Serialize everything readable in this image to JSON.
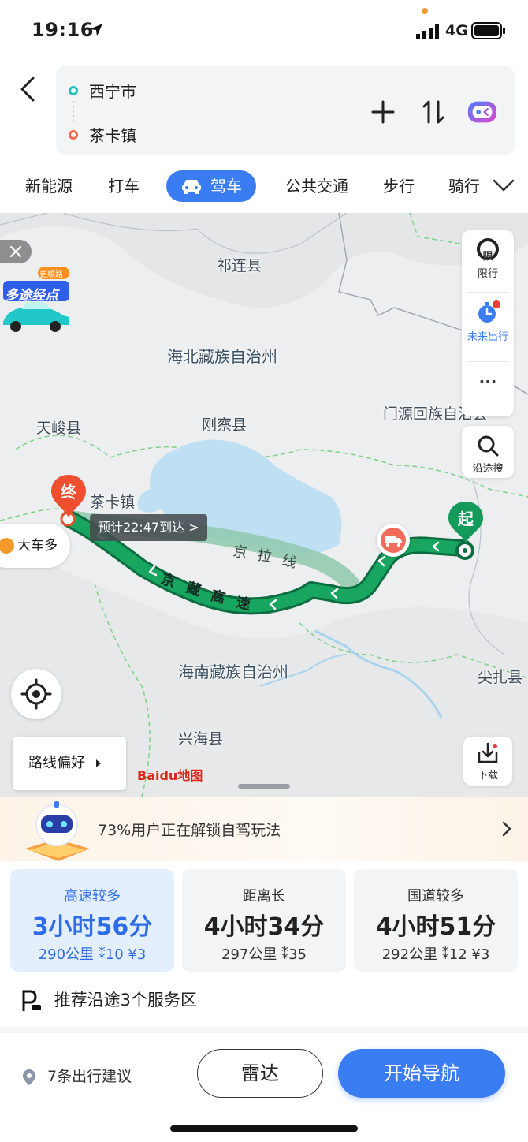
{
  "status_bar": {
    "time": "19:16",
    "network": "4G"
  },
  "header": {
    "origin": "西宁市",
    "destination": "茶卡镇"
  },
  "modes": {
    "items": [
      "新能源",
      "打车",
      "驾车",
      "公共交通",
      "步行",
      "骑行"
    ],
    "active": "驾车"
  },
  "map": {
    "places": {
      "qilian": "祁连县",
      "haibei": "海北藏族自治州",
      "tianjun": "天峻县",
      "gangcha": "刚察县",
      "menyuan": "门源回族自治县",
      "chaka": "茶卡镇",
      "hainan": "海南藏族自治州",
      "jianzha": "尖扎县",
      "xinghai": "兴海县"
    },
    "eta_label": "预计22:47到达 >",
    "end_marker": "终",
    "start_marker": "起",
    "alt_route_label": [
      "京",
      "拉",
      "线"
    ],
    "main_route_label": [
      "京",
      "藏",
      "高",
      "速"
    ],
    "right_panel": {
      "restriction": "限行",
      "future_trip": "未来出行",
      "more": "···",
      "search_along": "沿途搜",
      "download": "下载",
      "restriction_glyph": "限"
    },
    "promo": {
      "tag": "更顺路",
      "title": "多途经点"
    },
    "big_truck": "大车多",
    "route_pref": "路线偏好",
    "brand": "Baidu地图"
  },
  "banner": {
    "text": "73%用户正在解锁自驾玩法"
  },
  "routes": [
    {
      "tag": "高速较多",
      "duration": "3小时56分",
      "meta": "290公里 ⁑10 ¥3",
      "selected": true
    },
    {
      "tag": "距离长",
      "duration": "4小时34分",
      "meta": "297公里 ⁑35",
      "selected": false
    },
    {
      "tag": "国道较多",
      "duration": "4小时51分",
      "meta": "292公里 ⁑12 ¥3",
      "selected": false
    }
  ],
  "service": {
    "text": "推荐沿途3个服务区"
  },
  "bottom": {
    "tips": "7条出行建议",
    "radar": "雷达",
    "start_nav": "开始导航"
  },
  "colors": {
    "accent": "#3a7cf1",
    "route_green": "#149a5a",
    "alt_route": "#8fc9ad",
    "end_red": "#ef4e2f"
  }
}
